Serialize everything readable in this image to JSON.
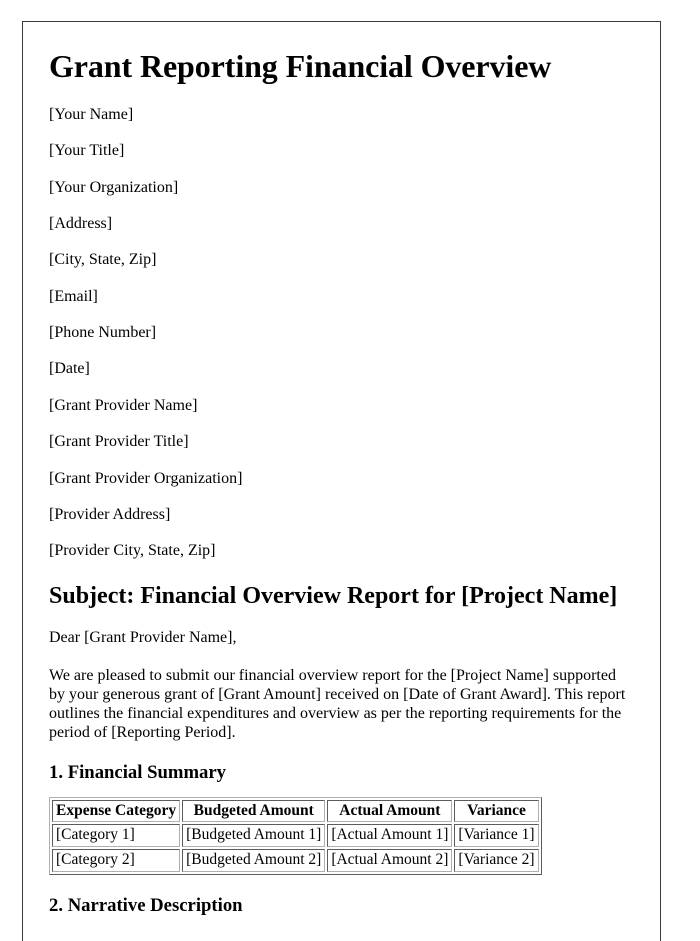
{
  "document": {
    "title": "Grant Reporting Financial Overview",
    "sender_block": [
      "[Your Name]",
      "[Your Title]",
      "[Your Organization]",
      "[Address]",
      "[City, State, Zip]",
      "[Email]",
      "[Phone Number]",
      "[Date]"
    ],
    "recipient_block": [
      "[Grant Provider Name]",
      "[Grant Provider Title]",
      "[Grant Provider Organization]",
      "[Provider Address]",
      "[Provider City, State, Zip]"
    ],
    "subject_heading": "Subject: Financial Overview Report for [Project Name]",
    "salutation": "Dear [Grant Provider Name],",
    "intro_paragraph": "We are pleased to submit our financial overview report for the [Project Name] supported by your generous grant of [Grant Amount] received on [Date of Grant Award]. This report outlines the financial expenditures and overview as per the reporting requirements for the period of [Reporting Period].",
    "section_one_heading": "1. Financial Summary",
    "financial_table": {
      "headers": [
        "Expense Category",
        "Budgeted Amount",
        "Actual Amount",
        "Variance"
      ],
      "rows": [
        [
          "[Category 1]",
          "[Budgeted Amount 1]",
          "[Actual Amount 1]",
          "[Variance 1]"
        ],
        [
          "[Category 2]",
          "[Budgeted Amount 2]",
          "[Actual Amount 2]",
          "[Variance 2]"
        ]
      ]
    },
    "section_two_heading": "2. Narrative Description"
  }
}
